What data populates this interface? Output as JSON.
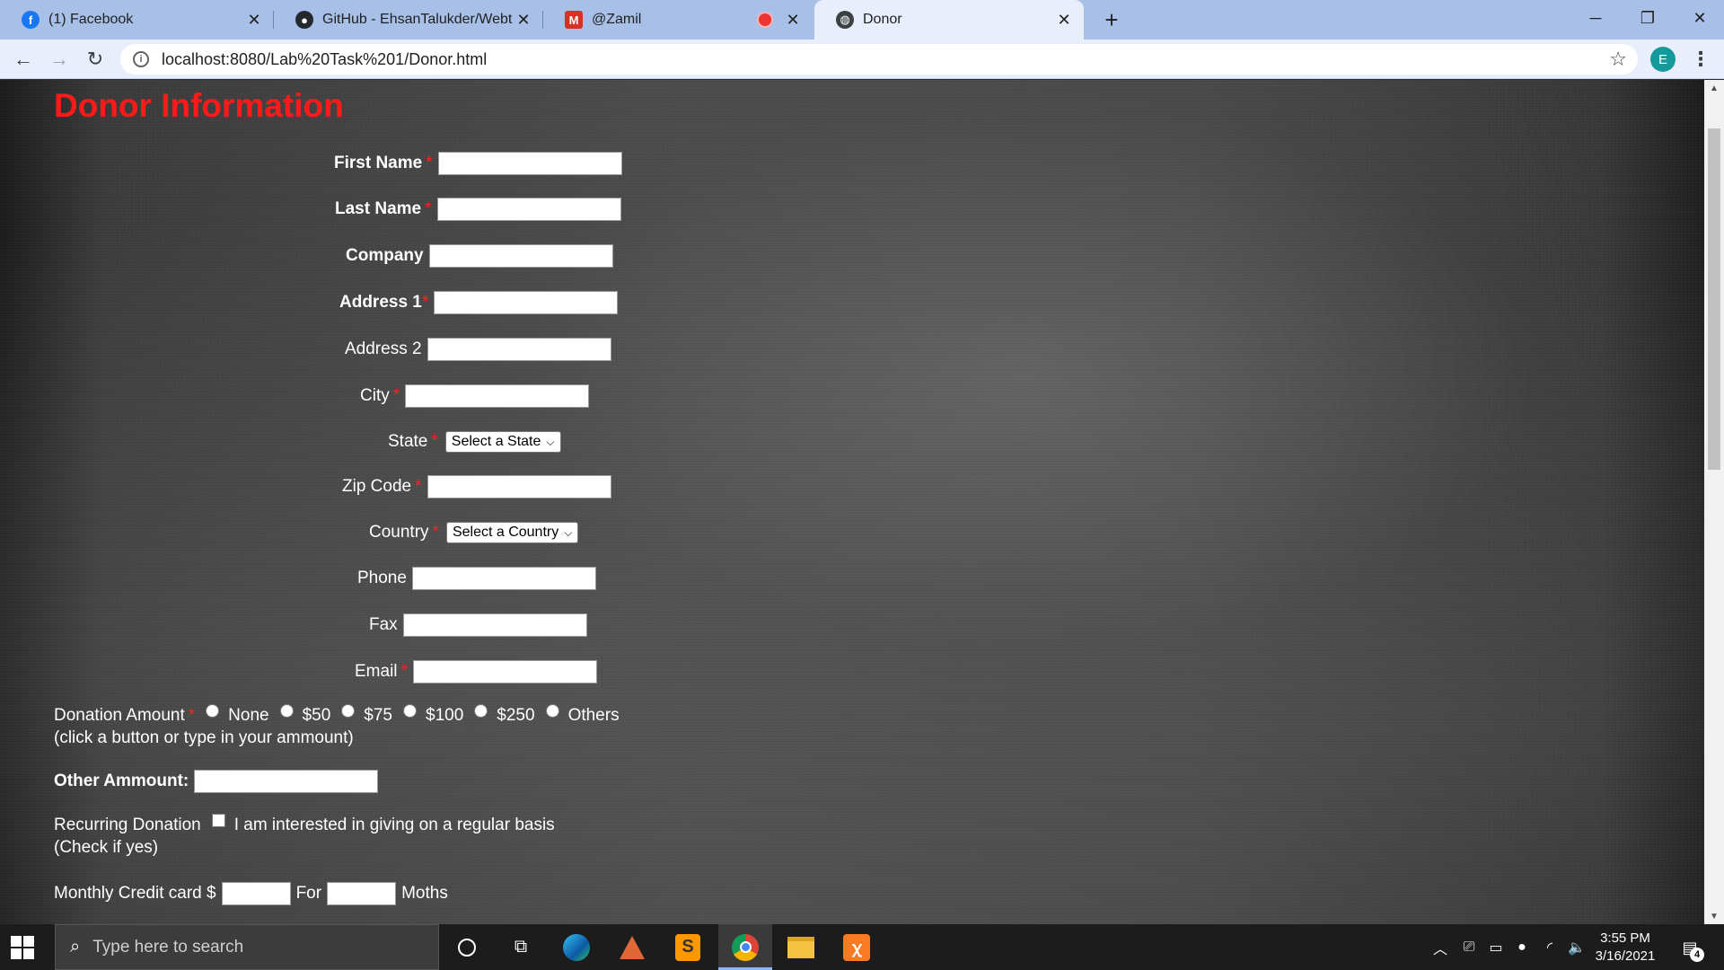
{
  "browser": {
    "tabs": [
      {
        "title": "(1) Facebook",
        "icon": "facebook-icon",
        "color": "#1877f2"
      },
      {
        "title": "GitHub - EhsanTalukder/Webtech",
        "icon": "github-icon",
        "color": "#24292e"
      },
      {
        "title": "@Zamil",
        "icon": "gmail-icon",
        "color": "#d93025"
      },
      {
        "title": "Donor",
        "icon": "globe-icon",
        "color": "#3c4043"
      }
    ],
    "active_tab": "Donor",
    "url": "localhost:8080/Lab%20Task%201/Donor.html",
    "profile_initial": "E"
  },
  "form": {
    "title": "Donor Information",
    "required_mark": "*",
    "first_name": "First Name",
    "last_name": "Last Name",
    "company": "Company",
    "address1": "Address 1",
    "address2": "Address 2",
    "city": "City",
    "state": "State",
    "state_select": "Select a State",
    "zip": "Zip Code",
    "country": "Country",
    "country_select": "Select a Country",
    "phone": "Phone",
    "fax": "Fax",
    "email": "Email",
    "donation_amount": "Donation Amount",
    "donation_options": [
      "None",
      "$50",
      "$75",
      "$100",
      "$250",
      "Others"
    ],
    "donation_hint": "(click a button or type in your ammount)",
    "other_amount": "Other Ammount:",
    "recurring": "Recurring Donation",
    "recurring_option": "I am interested in giving on a regular basis",
    "recurring_hint": "(Check if yes)",
    "monthly": "Monthly Credit card $",
    "for": "For",
    "months": "Moths"
  },
  "taskbar": {
    "search_placeholder": "Type here to search",
    "time": "3:55 PM",
    "date": "3/16/2021",
    "notification_count": "4"
  }
}
